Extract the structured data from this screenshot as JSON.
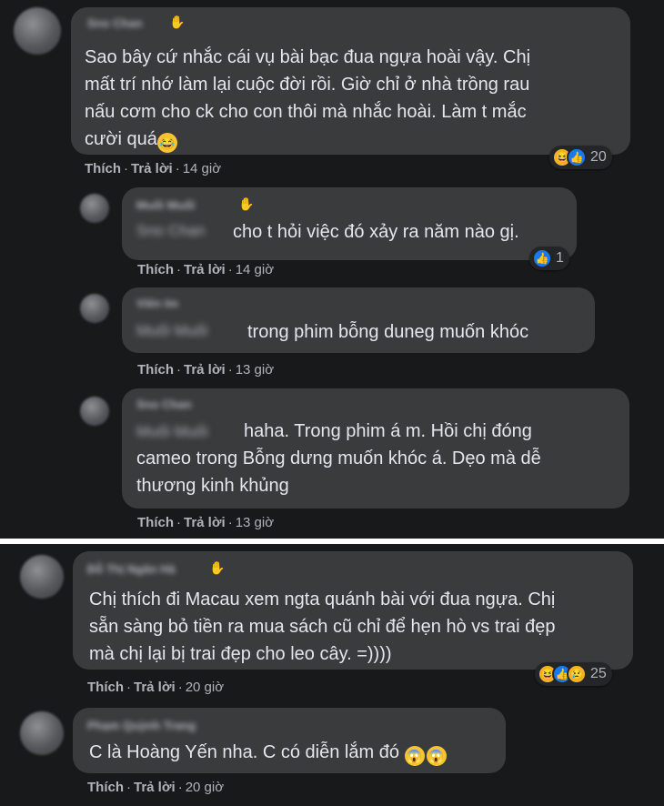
{
  "actions": {
    "like": "Thích",
    "reply": "Trả lời",
    "separator": "·"
  },
  "icons": {
    "haha": "laughing-emoji-icon",
    "like": "thumbs-up-icon",
    "sad": "sad-emoji-icon",
    "wave": "wave-hand-icon",
    "shocked": "shocked-emoji-icon"
  },
  "comments": [
    {
      "author": "Sno Chan",
      "lines": [
        "Sao bây cứ nhắc cái vụ bài bạc đua ngựa hoài vậy. Chị",
        "mất trí nhớ làm lại cuộc đời rồi. Giờ chỉ ở nhà trồng rau",
        "nấu cơm cho ck cho con thôi mà nhắc hoài. Làm t mắc",
        "cười quá"
      ],
      "time": "14 giờ",
      "reaction_count": "20"
    },
    {
      "author": "Muối Muối",
      "mention": "Sno Chan",
      "text": "cho t hỏi việc đó xảy ra năm nào gị.",
      "time": "14 giờ",
      "reaction_count": "1"
    },
    {
      "author": "Viên Im",
      "mention": "Muối Muối",
      "text": "trong phim bỗng duneg muốn khóc",
      "time": "13 giờ"
    },
    {
      "author": "Sno Chan",
      "mention": "Muối Muối",
      "lines": [
        "haha. Trong phim á m. Hồi chị đóng",
        "cameo trong Bỗng dưng muốn khóc á. Dẹo mà dễ",
        "thương kinh khủng"
      ],
      "time": "13 giờ"
    },
    {
      "author": "Đỗ Thị Ngân Hà",
      "lines": [
        "Chị thích đi Macau xem ngta quánh bài với đua ngựa. Chị",
        "sẵn sàng bỏ tiền ra mua sách cũ chỉ để hẹn hò vs trai đẹp",
        "mà chị lại bị trai đẹp cho leo cây. =))))"
      ],
      "time": "20 giờ",
      "reaction_count": "25"
    },
    {
      "author": "Phạm Quỳnh Trang",
      "text": "C là Hoàng Yến nha. C có diễn lắm đó",
      "time": "20 giờ"
    }
  ]
}
